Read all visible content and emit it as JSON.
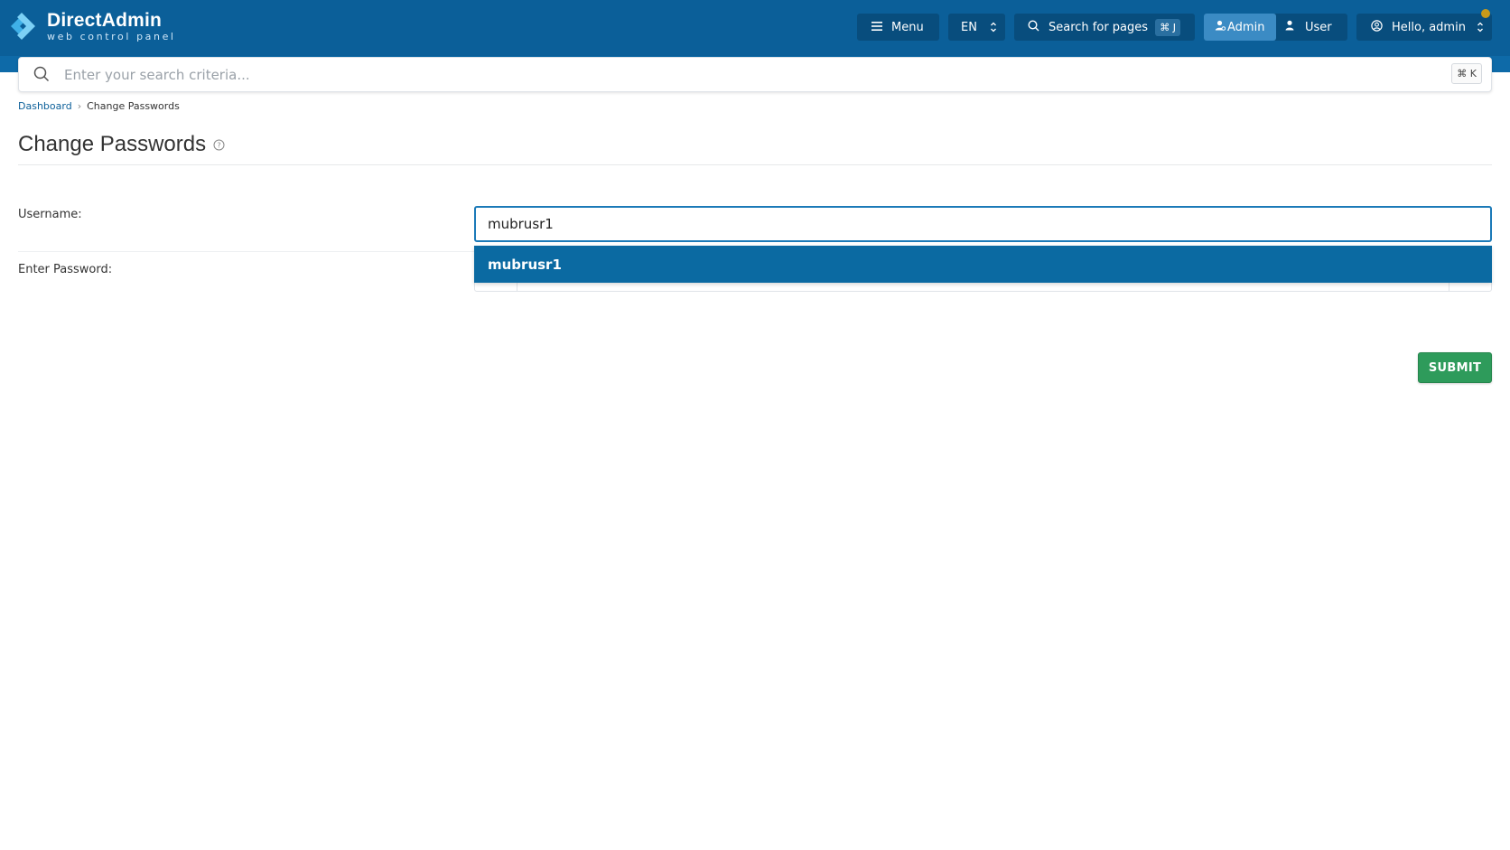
{
  "header": {
    "logo_title": "DirectAdmin",
    "logo_subtitle": "web control panel",
    "menu_label": "Menu",
    "language": "EN",
    "search_pages_label": "Search for pages",
    "search_pages_shortcut": "⌘ J",
    "role_admin": "Admin",
    "role_user": "User",
    "greeting": "Hello, admin"
  },
  "search": {
    "placeholder": "Enter your search criteria...",
    "shortcut": "⌘ K"
  },
  "breadcrumb": {
    "home": "Dashboard",
    "current": "Change Passwords"
  },
  "page": {
    "title": "Change Passwords"
  },
  "form": {
    "username_label": "Username:",
    "username_value": "mubrusr1",
    "password_label": "Enter Password:",
    "suggestion": "mubrusr1",
    "submit_label": "SUBMIT"
  },
  "colors": {
    "header_bg": "#0b5f99",
    "accent": "#0b6aa2",
    "submit": "#2e9b5b"
  }
}
